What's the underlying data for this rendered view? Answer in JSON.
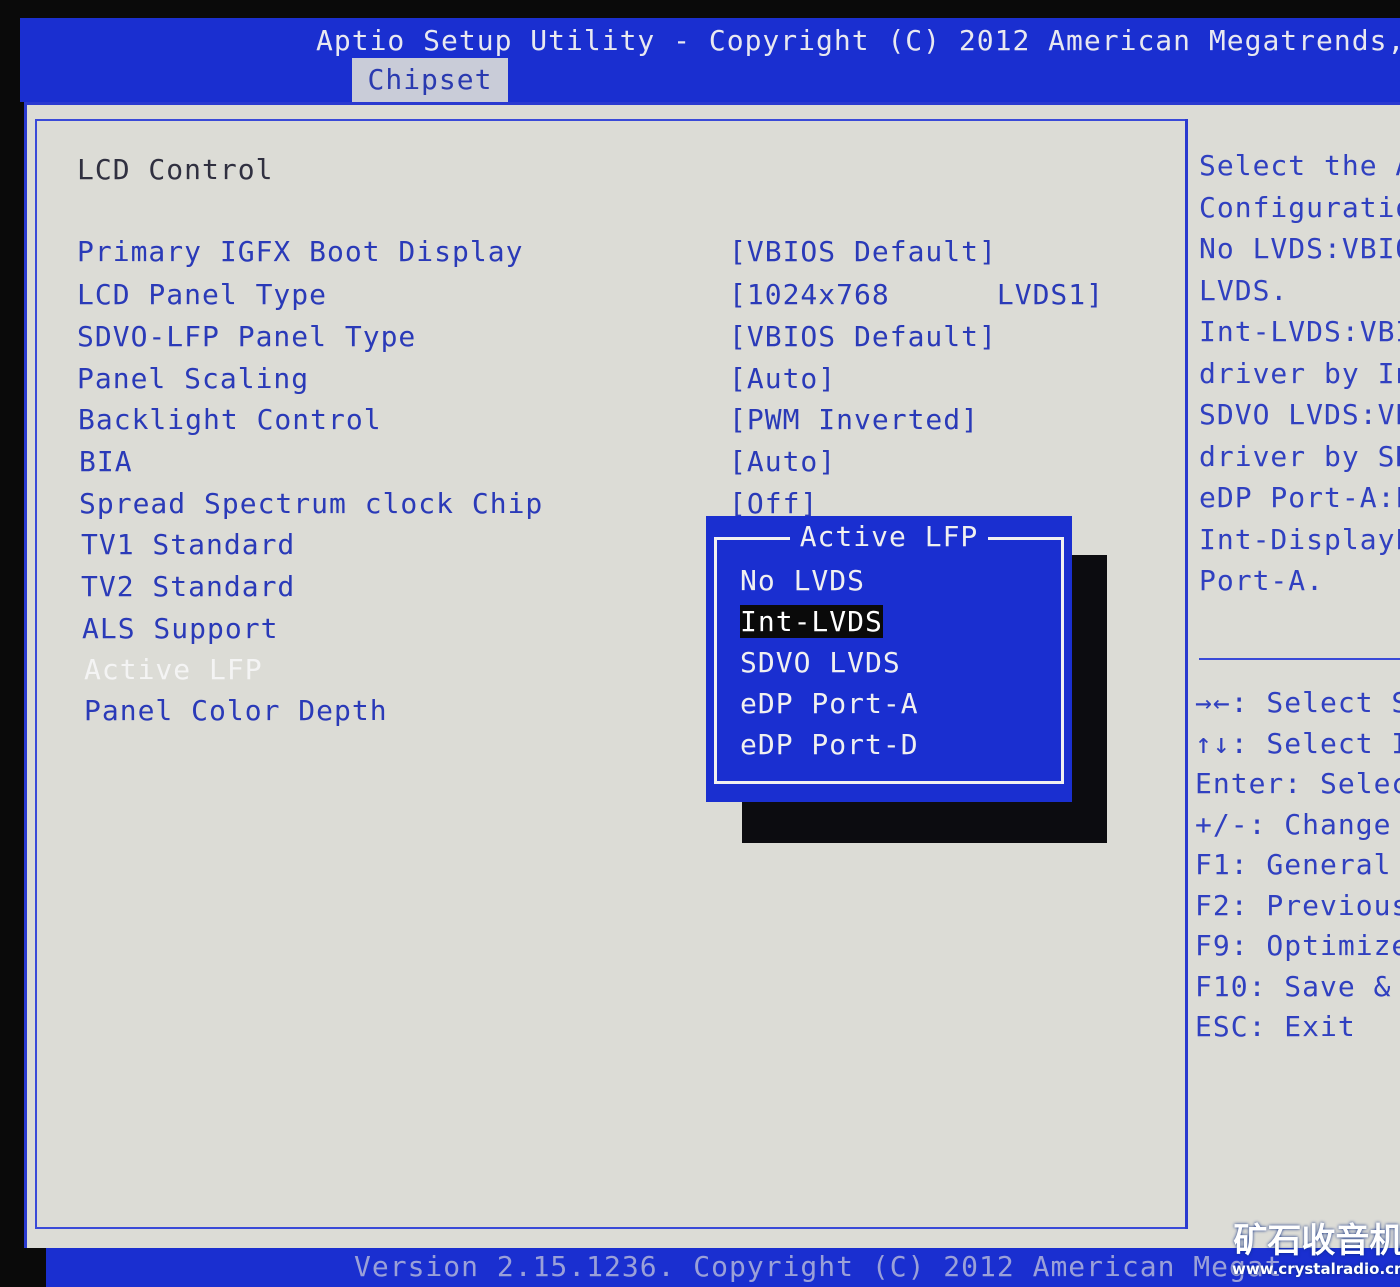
{
  "header": {
    "title": "Aptio Setup Utility - Copyright (C) 2012 American Megatrends,",
    "tab": "Chipset"
  },
  "section": "LCD Control",
  "items": [
    {
      "label": "Primary IGFX Boot Display",
      "value": "[VBIOS Default]"
    },
    {
      "label": "LCD Panel Type",
      "value": "[1024x768      LVDS1]"
    },
    {
      "label": "SDVO-LFP Panel Type",
      "value": "[VBIOS Default]"
    },
    {
      "label": "Panel Scaling",
      "value": "[Auto]"
    },
    {
      "label": "Backlight Control",
      "value": "[PWM Inverted]"
    },
    {
      "label": "BIA",
      "value": "[Auto]"
    },
    {
      "label": "Spread Spectrum clock Chip",
      "value": "[Off]"
    },
    {
      "label": "TV1 Standard",
      "value": ""
    },
    {
      "label": "TV2 Standard",
      "value": ""
    },
    {
      "label": "ALS Support",
      "value": ""
    },
    {
      "label": "Active LFP",
      "value": ""
    },
    {
      "label": "Panel Color Depth",
      "value": ""
    }
  ],
  "popup": {
    "title": "Active LFP",
    "options": [
      "No LVDS",
      "Int-LVDS",
      "SDVO LVDS",
      "eDP Port-A",
      "eDP Port-D"
    ],
    "selected": "Int-LVDS"
  },
  "help": [
    "Select the A",
    "Configuratio",
    "No LVDS:VBIO",
    "LVDS.",
    "Int-LVDS:VBI",
    "driver by In",
    "SDVO LVDS:VB",
    "driver by SD",
    "eDP Port-A:L",
    "Int-DisplayP",
    "Port-A."
  ],
  "keys": [
    "→←: Select S",
    "↑↓: Select I",
    "Enter: Selec",
    "+/-: Change",
    "F1: General",
    "F2: Previous",
    "F9: Optimize",
    "F10: Save & ",
    "ESC: Exit"
  ],
  "footer": "Version 2.15.1236. Copyright (C) 2012 American Megat",
  "watermark": {
    "name": "矿石收音机",
    "url": "www.crystalradio.cn"
  }
}
